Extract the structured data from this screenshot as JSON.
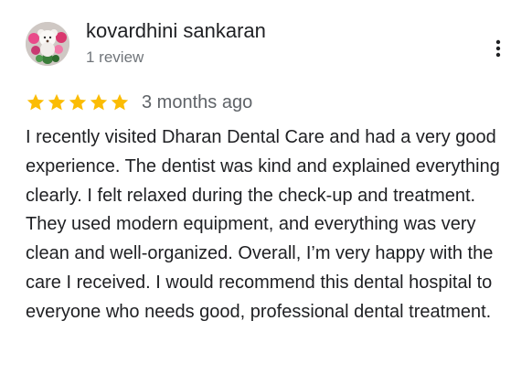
{
  "reviewer": {
    "name": "kovardhini sankaran",
    "review_count": "1 review",
    "avatar_icon": "profile-photo-teddy-bear-with-flowers"
  },
  "menu": {
    "icon": "more-vertical-icon"
  },
  "rating": {
    "stars": 5,
    "max_stars": 5,
    "star_color": "#fbbc04",
    "date": "3 months ago"
  },
  "review": {
    "text": "I recently visited Dharan Dental Care and had a very good experience. The dentist was kind and explained everything clearly. I felt relaxed during the check-up and treatment. They used modern equipment, and everything was very clean and well-organized. Overall, I’m very happy with the care I received. I would recommend this dental hospital to everyone who needs good, professional dental treatment."
  }
}
